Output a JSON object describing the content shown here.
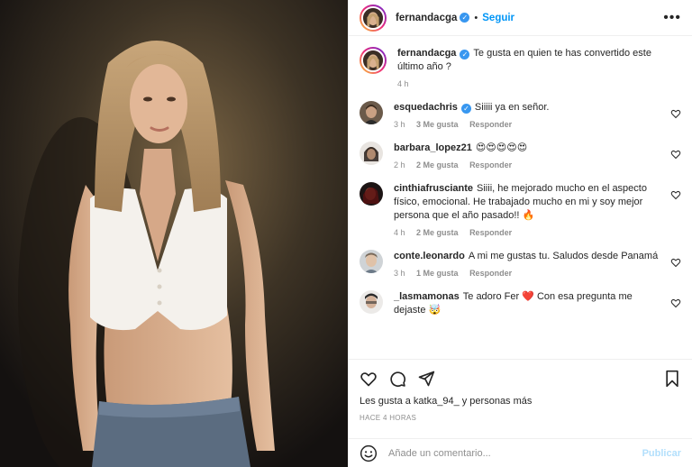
{
  "post": {
    "author": "fernandacga",
    "follow_label": "Seguir",
    "more_icon": "more-options-icon",
    "caption_text": "Te gusta en quien te has convertido este último año ?",
    "caption_time": "4 h"
  },
  "comments": [
    {
      "user": "esquedachris",
      "verified": true,
      "text": "Siiiii ya en señor.",
      "time": "3 h",
      "likes": "3 Me gusta",
      "reply": "Responder"
    },
    {
      "user": "barbara_lopez21",
      "verified": false,
      "text": "😍😍😍😍😍",
      "time": "2 h",
      "likes": "2 Me gusta",
      "reply": "Responder"
    },
    {
      "user": "cinthiafrusciante",
      "verified": false,
      "text": "Siiii, he mejorado mucho en el aspecto físico, emocional. He trabajado mucho en mi y soy mejor persona que el año pasado!! 🔥",
      "time": "4 h",
      "likes": "2 Me gusta",
      "reply": "Responder"
    },
    {
      "user": "conte.leonardo",
      "verified": false,
      "text": "A mi me gustas tu. Saludos desde Panamá",
      "time": "3 h",
      "likes": "1 Me gusta",
      "reply": "Responder"
    },
    {
      "user": "_lasmamonas",
      "verified": false,
      "text": "Te adoro Fer ❤️ Con esa pregunta me dejaste 🤯",
      "time": "",
      "likes": "",
      "reply": ""
    }
  ],
  "actions": {
    "likes_text": "Les gusta a katka_94_ y personas más",
    "time_ago": "HACE 4 HORAS"
  },
  "composer": {
    "placeholder": "Añade un comentario...",
    "publish_label": "Publicar"
  },
  "colors": {
    "accent": "#0095f6",
    "verified": "#3897f0",
    "muted": "#8e8e8e",
    "publish_disabled": "#b2dffc"
  }
}
